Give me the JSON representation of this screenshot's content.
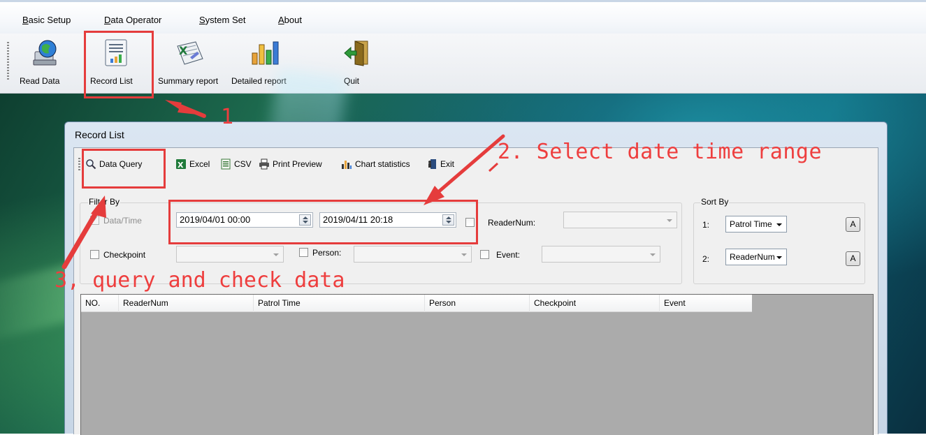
{
  "menu": {
    "items": [
      "Basic Setup",
      "Data Operator",
      "System Set",
      "About"
    ]
  },
  "toolbar": {
    "buttons": [
      {
        "label": "Read Data",
        "icon": "computer-globe-icon"
      },
      {
        "label": "Record List",
        "icon": "document-chart-icon"
      },
      {
        "label": "Summary report",
        "icon": "excel-report-icon"
      },
      {
        "label": "Detailed report",
        "icon": "bar-chart-icon"
      },
      {
        "label": "Quit",
        "icon": "exit-door-icon"
      }
    ]
  },
  "window": {
    "title": "Record List",
    "toolbar": {
      "data_query": "Data Query",
      "excel": "Excel",
      "csv": "CSV",
      "print_preview": "Print Preview",
      "chart_statistics": "Chart statistics",
      "exit": "Exit"
    },
    "filter": {
      "group_label": "Filter By",
      "datetime_label": "Data/Time",
      "date_from": "2019/04/01 00:00",
      "date_to": "2019/04/11 20:18",
      "readernum_label": "ReaderNum:",
      "checkpoint_label": "Checkpoint",
      "person_label": "Person:",
      "event_label": "Event:"
    },
    "sort": {
      "group_label": "Sort By",
      "row1_index": "1:",
      "row1_value": "Patrol Time",
      "row2_index": "2:",
      "row2_value": "ReaderNum",
      "order_label": "A"
    },
    "grid": {
      "columns": [
        "NO.",
        "ReaderNum",
        "Patrol Time",
        "Person",
        "Checkpoint",
        "Event"
      ]
    }
  },
  "annotations": {
    "step1": "1",
    "step2": "2. Select date time range",
    "step3": "3, query and check data"
  },
  "colors": {
    "annotation_red": "#e53c3c",
    "grid_empty": "#ababab"
  }
}
